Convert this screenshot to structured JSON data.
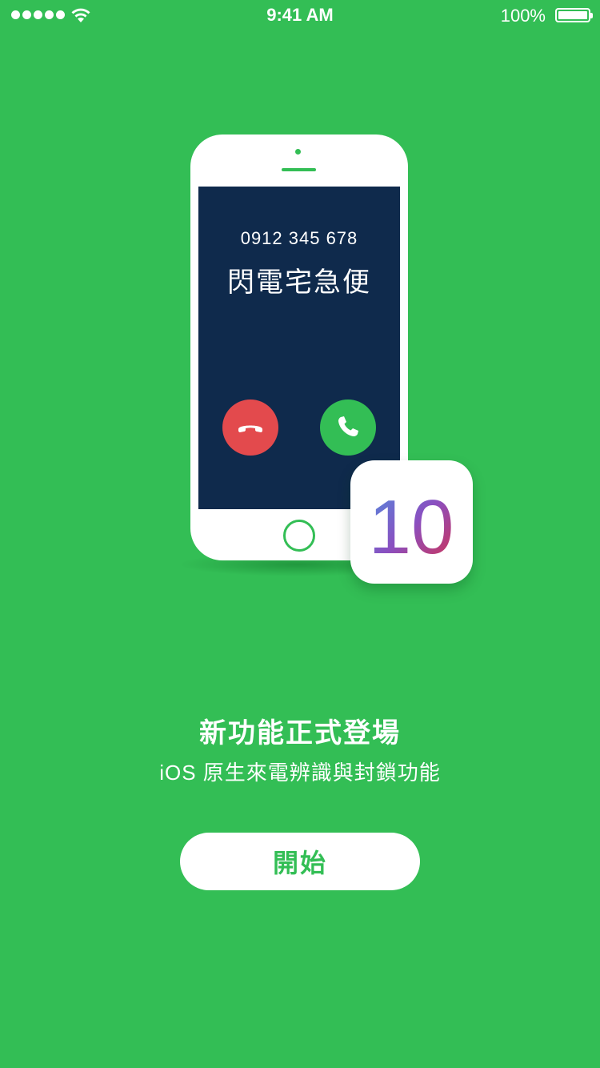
{
  "status_bar": {
    "time": "9:41 AM",
    "battery_percent": "100%",
    "signal_bars": 5,
    "wifi_icon": "wifi-icon",
    "battery_icon": "battery-icon"
  },
  "illustration": {
    "caller_number": "0912 345 678",
    "caller_name": "閃電宅急便",
    "decline_icon": "phone-decline-icon",
    "accept_icon": "phone-accept-icon",
    "badge_text": "10"
  },
  "headline": "新功能正式登場",
  "subline": "iOS 原生來電辨識與封鎖功能",
  "start_button": "開始",
  "colors": {
    "background": "#33BE55",
    "screen": "#0F2A4C",
    "decline": "#E34A4D",
    "accept": "#33BE55"
  }
}
